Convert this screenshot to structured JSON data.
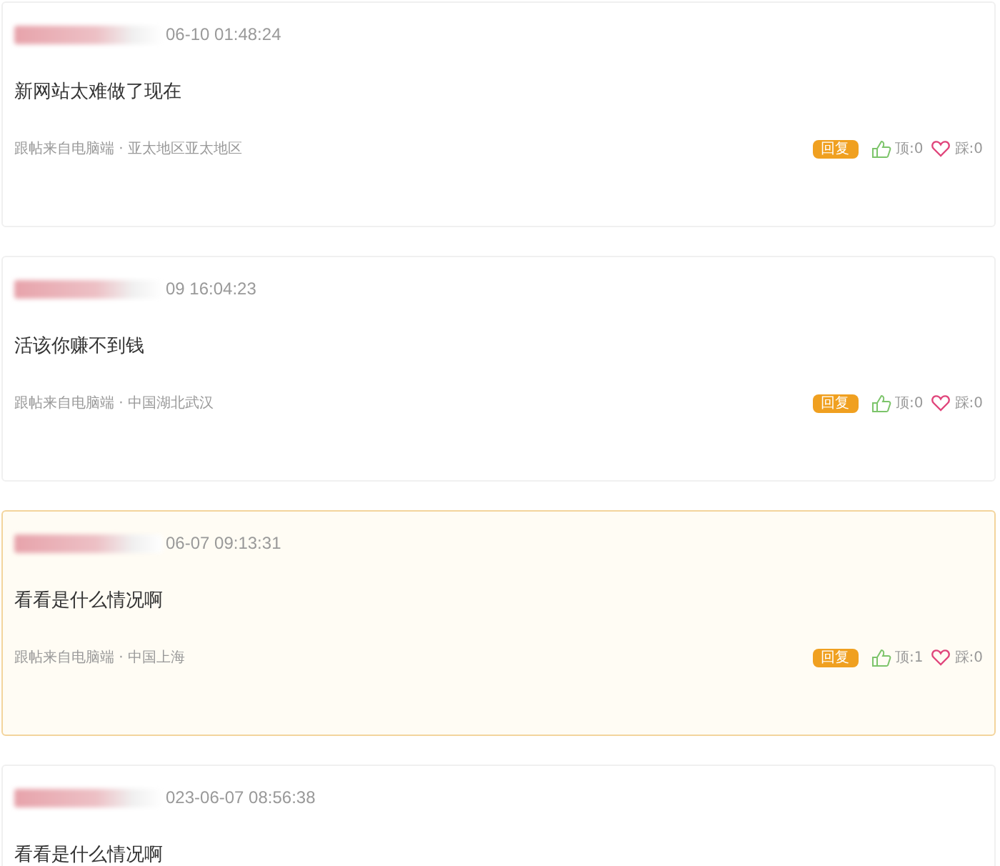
{
  "comments": [
    {
      "time": "06-10 01:48:24",
      "content": "新网站太难做了现在",
      "source": "跟帖来自电脑端 · 亚太地区亚太地区",
      "reply": "回复",
      "up": "顶:0",
      "down": "踩:0",
      "highlighted": false
    },
    {
      "time": "09 16:04:23",
      "content": "活该你赚不到钱",
      "source": "跟帖来自电脑端 · 中国湖北武汉",
      "reply": "回复",
      "up": "顶:0",
      "down": "踩:0",
      "highlighted": false
    },
    {
      "time": "06-07 09:13:31",
      "content": "看看是什么情况啊",
      "source": "跟帖来自电脑端 · 中国上海",
      "reply": "回复",
      "up": "顶:1",
      "down": "踩:0",
      "highlighted": true
    },
    {
      "time": "023-06-07 08:56:38",
      "content": "看看是什么情况啊",
      "highlighted": false
    }
  ]
}
